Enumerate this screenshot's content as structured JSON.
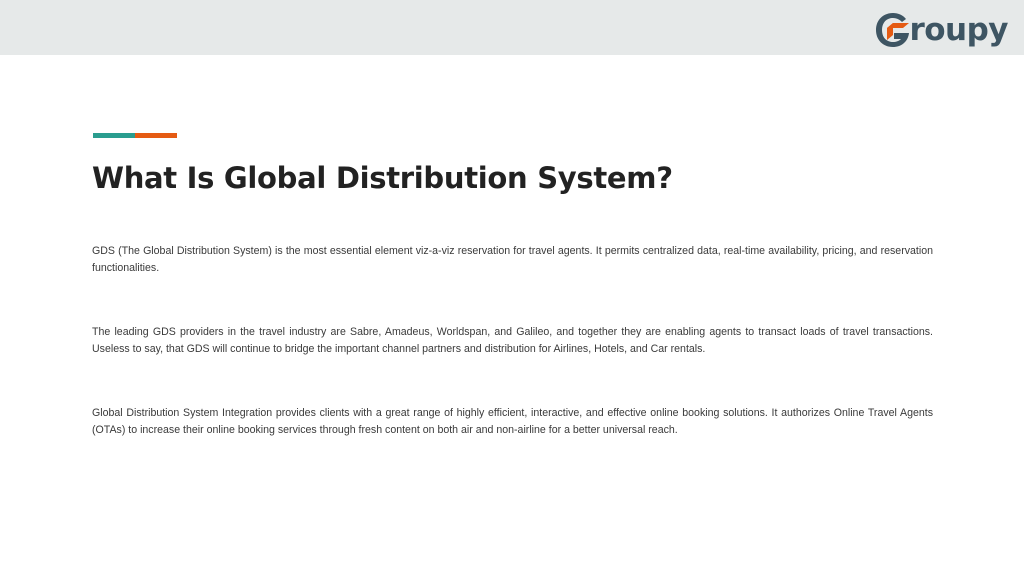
{
  "header": {
    "logo_text": "roupy",
    "logo_full": "Groupy",
    "brand_colors": {
      "logo_gray": "#3e5563",
      "logo_orange": "#e55b13",
      "band": "#e6e9e9"
    }
  },
  "accent": {
    "left_color": "#2a9d8f",
    "right_color": "#e55b13"
  },
  "main": {
    "title": "What Is Global Distribution System?",
    "paragraphs": [
      "GDS (The Global Distribution System) is the most essential element viz-a-viz reservation for travel agents. It permits centralized data, real-time availability, pricing, and reservation functionalities.",
      "The leading GDS providers in the travel industry are Sabre, Amadeus, Worldspan, and Galileo, and together they are enabling agents to transact loads of travel transactions. Useless to say, that GDS will continue to bridge the important channel partners and distribution for Airlines, Hotels, and Car rentals.",
      "Global Distribution System Integration provides clients with a great range of highly efficient, interactive, and effective online booking solutions. It authorizes Online Travel Agents (OTAs) to increase their online booking services through fresh content on both air and non-airline for a better universal reach."
    ]
  }
}
